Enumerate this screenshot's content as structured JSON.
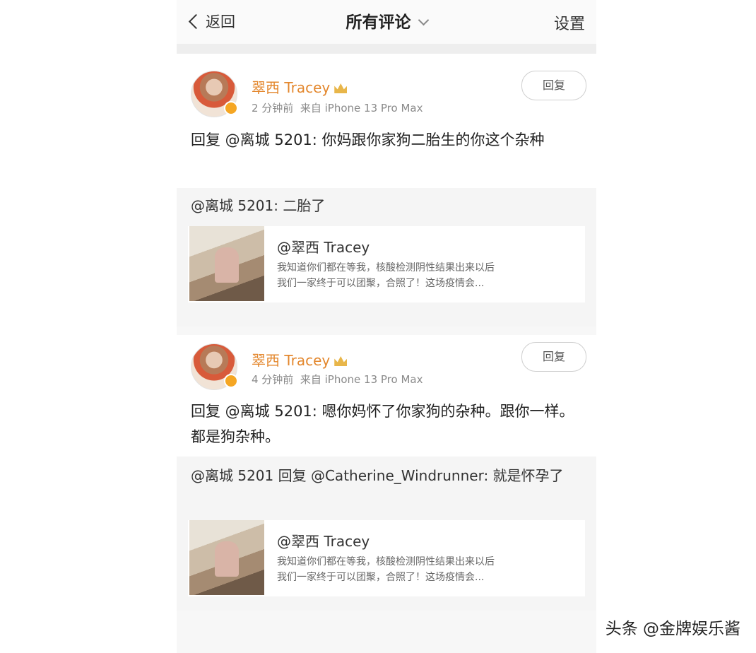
{
  "header": {
    "back_label": "返回",
    "title": "所有评论",
    "settings_label": "设置"
  },
  "comments": [
    {
      "username": "翠西 Tracey",
      "time": "2 分钟前",
      "device": "来自 iPhone 13 Pro Max",
      "reply_button": "回复",
      "text": "回复 @离城 5201: 你妈跟你家狗二胎生的你这个杂种",
      "quoted": "@离城 5201: 二胎了",
      "shared_post": {
        "author": "@翠西 Tracey",
        "line1": "我知道你们都在等我，核酸检测阴性结果出来以后",
        "line2": "我们一家终于可以团聚，合照了！这场疫情会..."
      }
    },
    {
      "username": "翠西 Tracey",
      "time": "4 分钟前",
      "device": "来自 iPhone 13 Pro Max",
      "reply_button": "回复",
      "text": "回复 @离城 5201: 嗯你妈怀了你家狗的杂种。跟你一样。都是狗杂种。",
      "quoted": "@离城 5201 回复 @Catherine_Windrunner: 就是怀孕了",
      "shared_post": {
        "author": "@翠西 Tracey",
        "line1": "我知道你们都在等我，核酸检测阴性结果出来以后",
        "line2": "我们一家终于可以团聚，合照了！这场疫情会..."
      }
    }
  ],
  "watermark": "头条 @金牌娱乐酱",
  "colors": {
    "username": "#e3872d",
    "meta": "#8a8a8a",
    "quote_bg": "#f5f5f5",
    "divider": "#eeeeee"
  }
}
